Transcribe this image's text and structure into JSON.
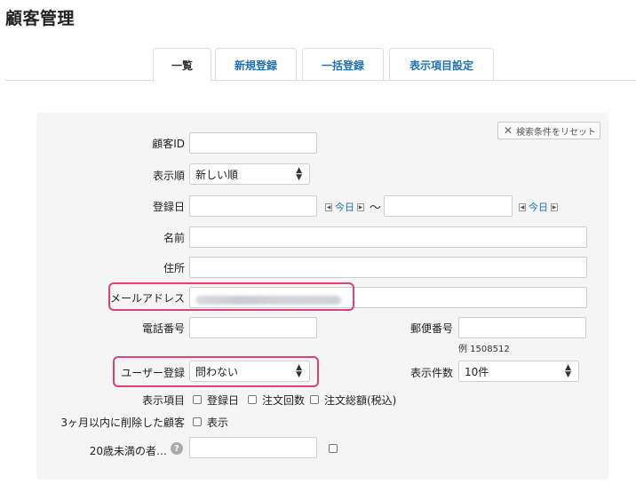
{
  "page": {
    "title": "顧客管理"
  },
  "tabs": [
    {
      "label": "一覧",
      "active": true
    },
    {
      "label": "新規登録",
      "active": false
    },
    {
      "label": "一括登録",
      "active": false
    },
    {
      "label": "表示項目設定",
      "active": false
    }
  ],
  "search": {
    "reset_label": "検索条件をリセット",
    "customer_id_label": "顧客ID",
    "customer_id_value": "",
    "sort_label": "表示順",
    "sort_value": "新しい順",
    "reg_date_label": "登録日",
    "reg_date_from": "",
    "reg_date_to": "",
    "today_label": "今日",
    "range_separator": "～",
    "name_label": "名前",
    "name_value": "",
    "address_label": "住所",
    "address_value": "",
    "email_label": "メールアドレス",
    "phone_label": "電話番号",
    "phone_value": "",
    "postal_label": "郵便番号",
    "postal_value": "",
    "postal_example": "例 1508512",
    "user_reg_label": "ユーザー登録",
    "user_reg_value": "問わない",
    "per_page_label": "表示件数",
    "per_page_value": "10件",
    "display_items_label": "表示項目",
    "display_items": [
      {
        "label": "登録日",
        "checked": false
      },
      {
        "label": "注文回数",
        "checked": false
      },
      {
        "label": "注文総額(税込)",
        "checked": false
      }
    ],
    "deleted_label": "3ヶ月以内に削除した顧客",
    "deleted_option_label": "表示",
    "minor_label": "20歳未満の者…",
    "minor_value": ""
  },
  "colors": {
    "accent": "#2271b5",
    "highlight": "#e0407c",
    "panel": "#f5f5f5"
  },
  "icons": {
    "reset": "close-icon",
    "help": "question-circle-icon",
    "select": "updown-arrows-icon"
  }
}
